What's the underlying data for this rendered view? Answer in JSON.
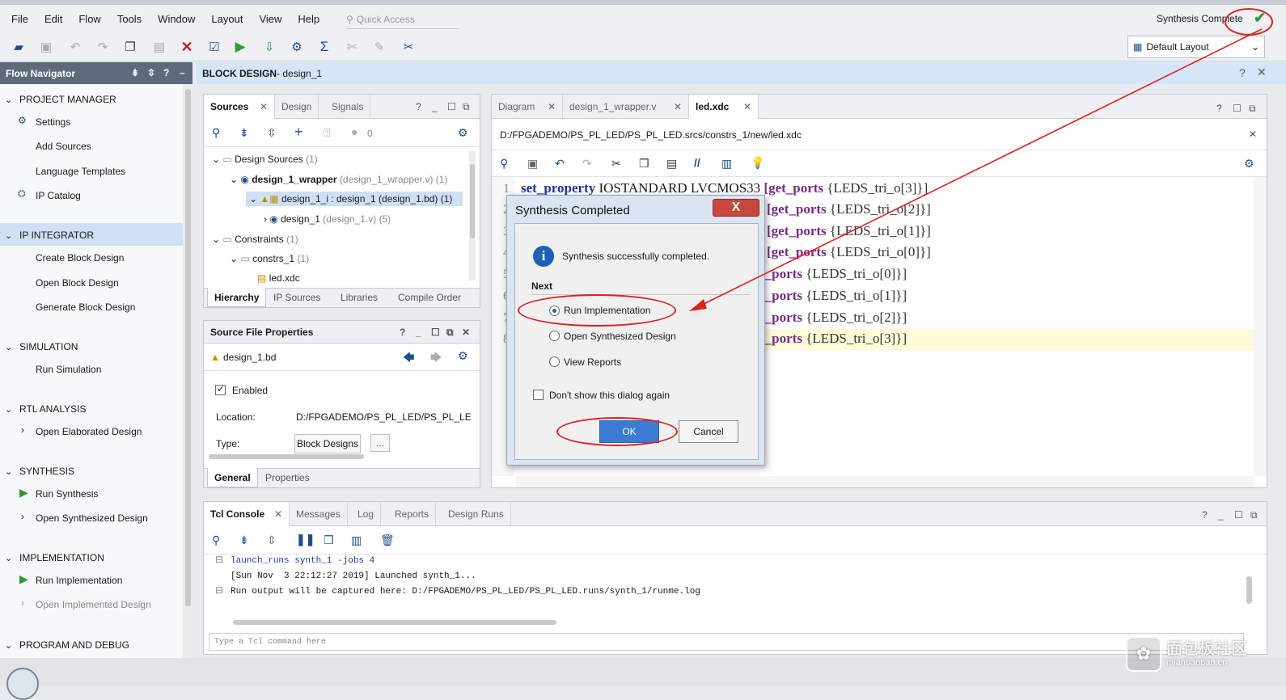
{
  "menubar": {
    "items": [
      "File",
      "Edit",
      "Flow",
      "Tools",
      "Window",
      "Layout",
      "View",
      "Help"
    ],
    "quick_access": "Quick Access",
    "status": "Synthesis Complete",
    "layout_select": "Default Layout"
  },
  "flow_navigator": {
    "title": "Flow Navigator",
    "sections": [
      {
        "title": "PROJECT MANAGER",
        "items": [
          "Settings",
          "Add Sources",
          "Language Templates",
          "IP Catalog"
        ]
      },
      {
        "title": "IP INTEGRATOR",
        "items": [
          "Create Block Design",
          "Open Block Design",
          "Generate Block Design"
        ]
      },
      {
        "title": "SIMULATION",
        "items": [
          "Run Simulation"
        ]
      },
      {
        "title": "RTL ANALYSIS",
        "items": [
          "Open Elaborated Design"
        ]
      },
      {
        "title": "SYNTHESIS",
        "items": [
          "Run Synthesis",
          "Open Synthesized Design"
        ]
      },
      {
        "title": "IMPLEMENTATION",
        "items": [
          "Run Implementation",
          "Open Implemented Design"
        ]
      },
      {
        "title": "PROGRAM AND DEBUG",
        "items": []
      }
    ]
  },
  "block_design": {
    "label": "BLOCK DESIGN",
    "name": " - design_1"
  },
  "sources": {
    "tabs": [
      "Sources",
      "Design",
      "Signals"
    ],
    "badge_count": "0",
    "tree": {
      "design_sources": "Design Sources",
      "design_sources_count": "(1)",
      "wrapper": "design_1_wrapper",
      "wrapper_file": "(design_1_wrapper.v) (1)",
      "design_i": "design_1_i : design_1 (design_1.bd) (1)",
      "design_1": "design_1",
      "design_1_file": "(design_1.v) (5)",
      "constraints": "Constraints",
      "constraints_count": "(1)",
      "constrs": "constrs_1",
      "constrs_count": "(1)",
      "xdc": "led.xdc"
    },
    "bottom_tabs": [
      "Hierarchy",
      "IP Sources",
      "Libraries",
      "Compile Order"
    ]
  },
  "properties": {
    "title": "Source File Properties",
    "file": "design_1.bd",
    "enabled": "Enabled",
    "location_label": "Location:",
    "location_value": "D:/FPGADEMO/PS_PL_LED/PS_PL_LE",
    "type_label": "Type:",
    "type_value": "Block Designs",
    "type_more": "...",
    "bottom_tabs": [
      "General",
      "Properties"
    ]
  },
  "editor": {
    "tabs": [
      "Diagram",
      "design_1_wrapper.v",
      "led.xdc"
    ],
    "path": "D:/FPGADEMO/PS_PL_LED/PS_PL_LED.srcs/constrs_1/new/led.xdc",
    "lines": [
      {
        "n": "1",
        "kw": "set_property",
        "mid": " IOSTANDARD LVCMOS33 ",
        "fn": "[get_ports",
        "arg": " {LEDS_tri_o[3]}]"
      },
      {
        "n": "2",
        "kw": "",
        "mid": "",
        "fn": "[get_ports",
        "arg": " {LEDS_tri_o[2]}]"
      },
      {
        "n": "3",
        "kw": "",
        "mid": "",
        "fn": "[get_ports",
        "arg": " {LEDS_tri_o[1]}]"
      },
      {
        "n": "4",
        "kw": "",
        "mid": "",
        "fn": "[get_ports",
        "arg": " {LEDS_tri_o[0]}]"
      },
      {
        "n": "5",
        "kw": "",
        "mid": "",
        "fn": "t_ports",
        "arg": " {LEDS_tri_o[0]}]"
      },
      {
        "n": "6",
        "kw": "",
        "mid": "",
        "fn": "t_ports",
        "arg": " {LEDS_tri_o[1]}]"
      },
      {
        "n": "7",
        "kw": "",
        "mid": "",
        "fn": "t_ports",
        "arg": " {LEDS_tri_o[2]}]"
      },
      {
        "n": "8",
        "kw": "",
        "mid": "",
        "fn": "t_ports",
        "arg": " {LEDS_tri_o[3]}]"
      }
    ]
  },
  "dialog": {
    "title": "Synthesis Completed",
    "message": "Synthesis successfully completed.",
    "next_label": "Next",
    "options": [
      {
        "label": "Run Implementation",
        "selected": true
      },
      {
        "label": "Open Synthesized Design",
        "selected": false
      },
      {
        "label": "View Reports",
        "selected": false
      }
    ],
    "dont_show": "Don't show this dialog again",
    "ok": "OK",
    "cancel": "Cancel",
    "close": "X"
  },
  "console": {
    "tabs": [
      "Tcl Console",
      "Messages",
      "Log",
      "Reports",
      "Design Runs"
    ],
    "lines": [
      "launch_runs synth_1 -jobs 4",
      "[Sun Nov  3 22:12:27 2019] Launched synth_1...",
      "Run output will be captured here: D:/FPGADEMO/PS_PL_LED/PS_PL_LED.runs/synth_1/runme.log"
    ],
    "input_placeholder": "Type a Tcl command here"
  },
  "watermark": {
    "text": "面包板社区",
    "sub": "mianbaoban.cn"
  },
  "colors": {
    "accent": "#3b7bd4",
    "annotation": "#e02020",
    "selection": "#cfe0f5",
    "run_green": "#2a9d3a"
  }
}
